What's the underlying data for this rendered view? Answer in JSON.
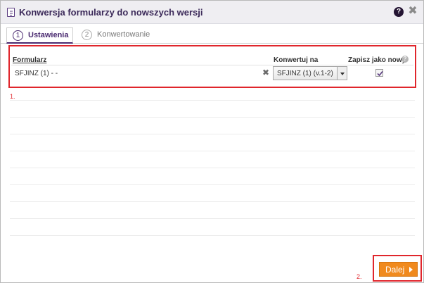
{
  "dialog": {
    "title": "Konwersja formularzy do nowszych wersji",
    "help_symbol": "?",
    "close_symbol": "✖"
  },
  "tabs": [
    {
      "number": "1",
      "label": "Ustawienia",
      "active": true
    },
    {
      "number": "2",
      "label": "Konwertowanie",
      "active": false
    }
  ],
  "table": {
    "headers": {
      "formularz": "Formularz",
      "konwertuj_na": "Konwertuj na",
      "zapisz_jako_nowy": "Zapisz jako nowy",
      "help_symbol": "?"
    },
    "rows": [
      {
        "formularz": "SFJINZ (1) -  -",
        "remove_symbol": "✖",
        "konwertuj_na": "SFJINZ (1) (v.1-2)",
        "zapisz_jako_nowy": true
      }
    ]
  },
  "annotations": {
    "first": "1.",
    "second": "2."
  },
  "footer": {
    "next_label": "Dalej"
  },
  "colors": {
    "accent": "#4a2a70",
    "highlight": "#e0262c",
    "next_button": "#f08a1e"
  }
}
